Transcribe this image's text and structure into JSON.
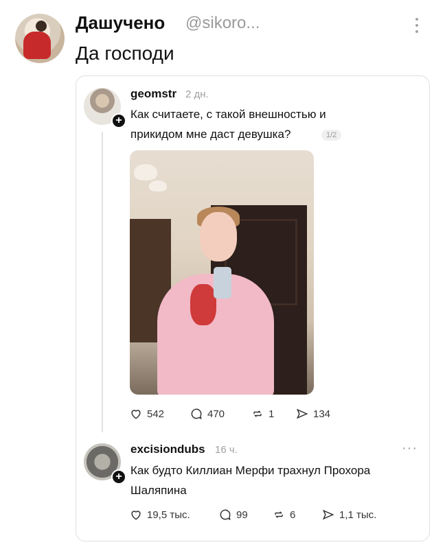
{
  "post": {
    "author_name": "Дашучено",
    "author_handle": "@sikoro...",
    "text": "Да господи",
    "menu_icon": "vertical-dots-icon"
  },
  "quoted": {
    "username": "geomstr",
    "time": "2 дн.",
    "text": "Как считаете, с такой внешностью и прикидом мне даст девушка?",
    "counter": "1/2",
    "actions": {
      "likes": "542",
      "comments": "470",
      "reposts": "1",
      "shares": "134"
    },
    "photo_alt": "selfie-photo"
  },
  "reply": {
    "username": "excisiondubs",
    "time": "16 ч.",
    "more": "···",
    "text": "Как будто Киллиан Мерфи трахнул Прохора Шаляпина",
    "actions": {
      "likes": "19,5 тыс.",
      "comments": "99",
      "reposts": "6",
      "shares": "1,1 тыс."
    }
  },
  "plus_symbol": "+"
}
